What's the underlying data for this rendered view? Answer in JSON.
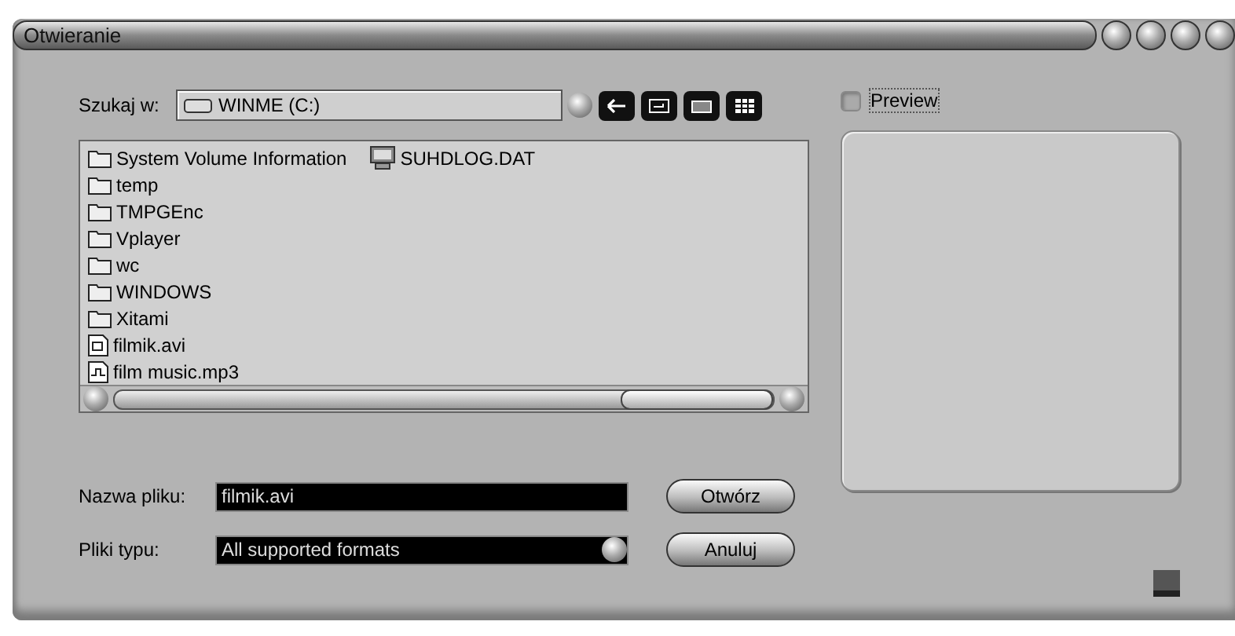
{
  "window": {
    "title": "Otwieranie"
  },
  "look_in": {
    "label": "Szukaj w:",
    "value": "WINME (C:)"
  },
  "files": [
    {
      "name": "System Volume Information",
      "kind": "folder",
      "selected": false
    },
    {
      "name": "temp",
      "kind": "folder",
      "selected": false
    },
    {
      "name": "TMPGEnc",
      "kind": "folder",
      "selected": false
    },
    {
      "name": "Vplayer",
      "kind": "folder",
      "selected": false
    },
    {
      "name": "wc",
      "kind": "folder",
      "selected": false
    },
    {
      "name": "WINDOWS",
      "kind": "folder",
      "selected": false
    },
    {
      "name": "Xitami",
      "kind": "folder",
      "selected": false
    },
    {
      "name": "filmik.avi",
      "kind": "video",
      "selected": false
    },
    {
      "name": "film music.mp3",
      "kind": "audio",
      "selected": false
    },
    {
      "name": "SUHDLOG.DAT",
      "kind": "system",
      "selected": false
    }
  ],
  "file_name": {
    "label": "Nazwa pliku:",
    "value": "filmik.avi"
  },
  "file_type": {
    "label": "Pliki typu:",
    "value": "All supported formats"
  },
  "buttons": [
    {
      "label": "Otwórz"
    },
    {
      "label": "Anuluj"
    }
  ],
  "preview": {
    "label": "Preview",
    "checked": false
  }
}
